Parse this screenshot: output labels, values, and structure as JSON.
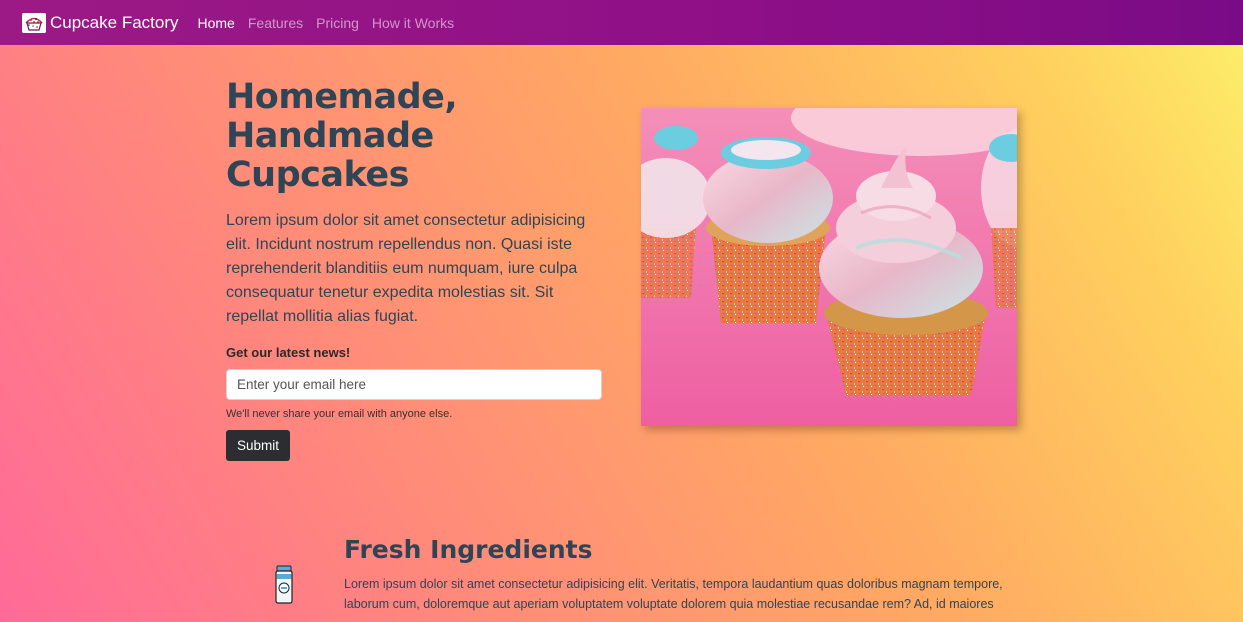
{
  "nav": {
    "brand": "Cupcake Factory",
    "links": [
      {
        "label": "Home",
        "active": true
      },
      {
        "label": "Features",
        "active": false
      },
      {
        "label": "Pricing",
        "active": false
      },
      {
        "label": "How it Works",
        "active": false
      }
    ]
  },
  "hero": {
    "title": "Homemade, Handmade Cupcakes",
    "body": "Lorem ipsum dolor sit amet consectetur adipisicing elit. Incidunt nostrum repellendus non. Quasi iste reprehenderit blanditiis eum numquam, iure culpa consequatur tenetur expedita molestias sit. Sit repellat mollitia alias fugiat.",
    "news_label": "Get our latest news!",
    "email_placeholder": "Enter your email here",
    "help_text": "We'll never share your email with anyone else.",
    "submit_label": "Submit"
  },
  "feature": {
    "title": "Fresh Ingredients",
    "body": "Lorem ipsum dolor sit amet consectetur adipisicing elit. Veritatis, tempora laudantium quas doloribus magnam tempore, laborum cum, doloremque aut aperiam voluptatem voluptate dolorem quia molestiae recusandae rem? Ad, id maiores",
    "icon": "milk-bottle-icon"
  },
  "colors": {
    "navbar": "#8e0f87",
    "heading": "#2f4556",
    "button": "#2b2d30"
  }
}
